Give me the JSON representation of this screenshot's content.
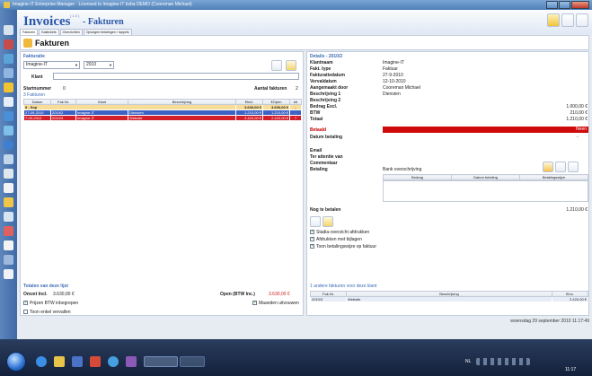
{
  "window": {
    "title": "Imagine-IT Enterprise Manager · Licensed to Imagine-IT bvba DEMO (Cooreman Michael)"
  },
  "header": {
    "title": "Invoices",
    "version": "( 1.0 )",
    "subtitle": "- Fakturen",
    "tabs": [
      "Fakturen",
      "Kastickets",
      "Overzichten",
      "Opvolgen betalingen / rappels"
    ]
  },
  "page": {
    "title": "Fakturen"
  },
  "invoice_panel": {
    "section_title": "Fakturatie",
    "company_select": "Imagine-IT",
    "year_select": "2010",
    "klant_label": "Klant",
    "startnummer_label": "Startnummer",
    "startnummer_value": "0",
    "aantal_label": "Aantal fakturen",
    "aantal_value": "2",
    "list_title": "3 Fakturen",
    "columns": [
      "Datum",
      "Fak.Nr.",
      "Klant",
      "Beschrijving",
      "€Incl.",
      "€Open",
      "#d"
    ],
    "group_row": {
      "label": "9 - Sep",
      "incl": "3.630,00 €",
      "open": "3.630,00 €",
      "days": "-"
    },
    "rows": [
      {
        "datum": "27-09-2010",
        "nr": "2010/2",
        "klant": "Imagine-IT",
        "beschrijving": "Diensten",
        "incl": "1.210,00 €",
        "open": "1.210,00 €",
        "days": "-"
      },
      {
        "datum": "7-09-2010",
        "nr": "2010/3",
        "klant": "Imagine-IT",
        "beschrijving": "Website",
        "incl": "2.420,00 €",
        "open": "2.420,00 €",
        "days": "7"
      }
    ]
  },
  "totals": {
    "section_title": "Totalen van deze lijst",
    "omzet_label": "Omzet Incl.",
    "omzet_value": "3.630,00 €",
    "open_label": "Open (BTW Inc.)",
    "open_value": "3.630,00 €",
    "prijzen_btw": "Prijzen BTW inbegrepen",
    "toon_vervallen": "Toon enkel vervallen",
    "maanden": "Maanden uitvouwen"
  },
  "details": {
    "section_title": "Details - 2010/2",
    "fields": [
      {
        "label": "Klantnaam",
        "value": "Imagine-IT"
      },
      {
        "label": "Fakt. type",
        "value": "Faktuur"
      },
      {
        "label": "Fakturatiedatum",
        "value": "27-9-2010"
      },
      {
        "label": "Vervaldatum",
        "value": "12-10-2010"
      },
      {
        "label": "Aangemaakt door",
        "value": "Cooreman Michael"
      },
      {
        "label": "Beschrijving 1",
        "value": "Diensten"
      },
      {
        "label": "Beschrijving 2",
        "value": ""
      }
    ],
    "bedrag_label": "Bedrag Excl.",
    "bedrag_value": "1.000,00 €",
    "btw_label": "BTW",
    "btw_value": "210,00 €",
    "totaal_label": "Totaal",
    "totaal_value": "1.210,00 €",
    "betaald_label": "Betaald",
    "betaald_value": "Neen",
    "datum_betaling_label": "Datum betaling",
    "datum_betaling_value": "-",
    "email_label": "Email",
    "attentie_label": "Ter attentie van",
    "commentaar_label": "Commentaar",
    "betaling_label": "Betaling",
    "betaling_value": "Bank overschrijving",
    "pay_columns": [
      "Bedrag",
      "Datum betaling",
      "Betalingswijze"
    ],
    "nog_label": "Nog te betalen",
    "nog_value": "1.210,00 €",
    "opt_stadia": "Stadia-overzicht afdrukken",
    "opt_bijlagen": "Afdrukken met bijlagen",
    "opt_toon": "Toon betalingswijze op faktuur"
  },
  "other_invoices": {
    "section_title": "1 andere fakturen voor deze klant",
    "columns": [
      "Fak.Nr.",
      "Beschrijving",
      "€Inc."
    ],
    "rows": [
      {
        "nr": "2010/3",
        "beschrijving": "Website",
        "inc": "2.420,00 €"
      }
    ]
  },
  "statusbar": {
    "datetime": "woensdag 29 september 2010 11:17:49"
  },
  "taskbar": {
    "time": "11:17",
    "tray_lang": "NL"
  },
  "colors": {
    "accent": "#3d6cb5",
    "selected_row": "#3b62c4",
    "overdue_row": "#d21f2b",
    "group_row": "#f7dd97",
    "betaald_bg": "#cf0a0a"
  }
}
